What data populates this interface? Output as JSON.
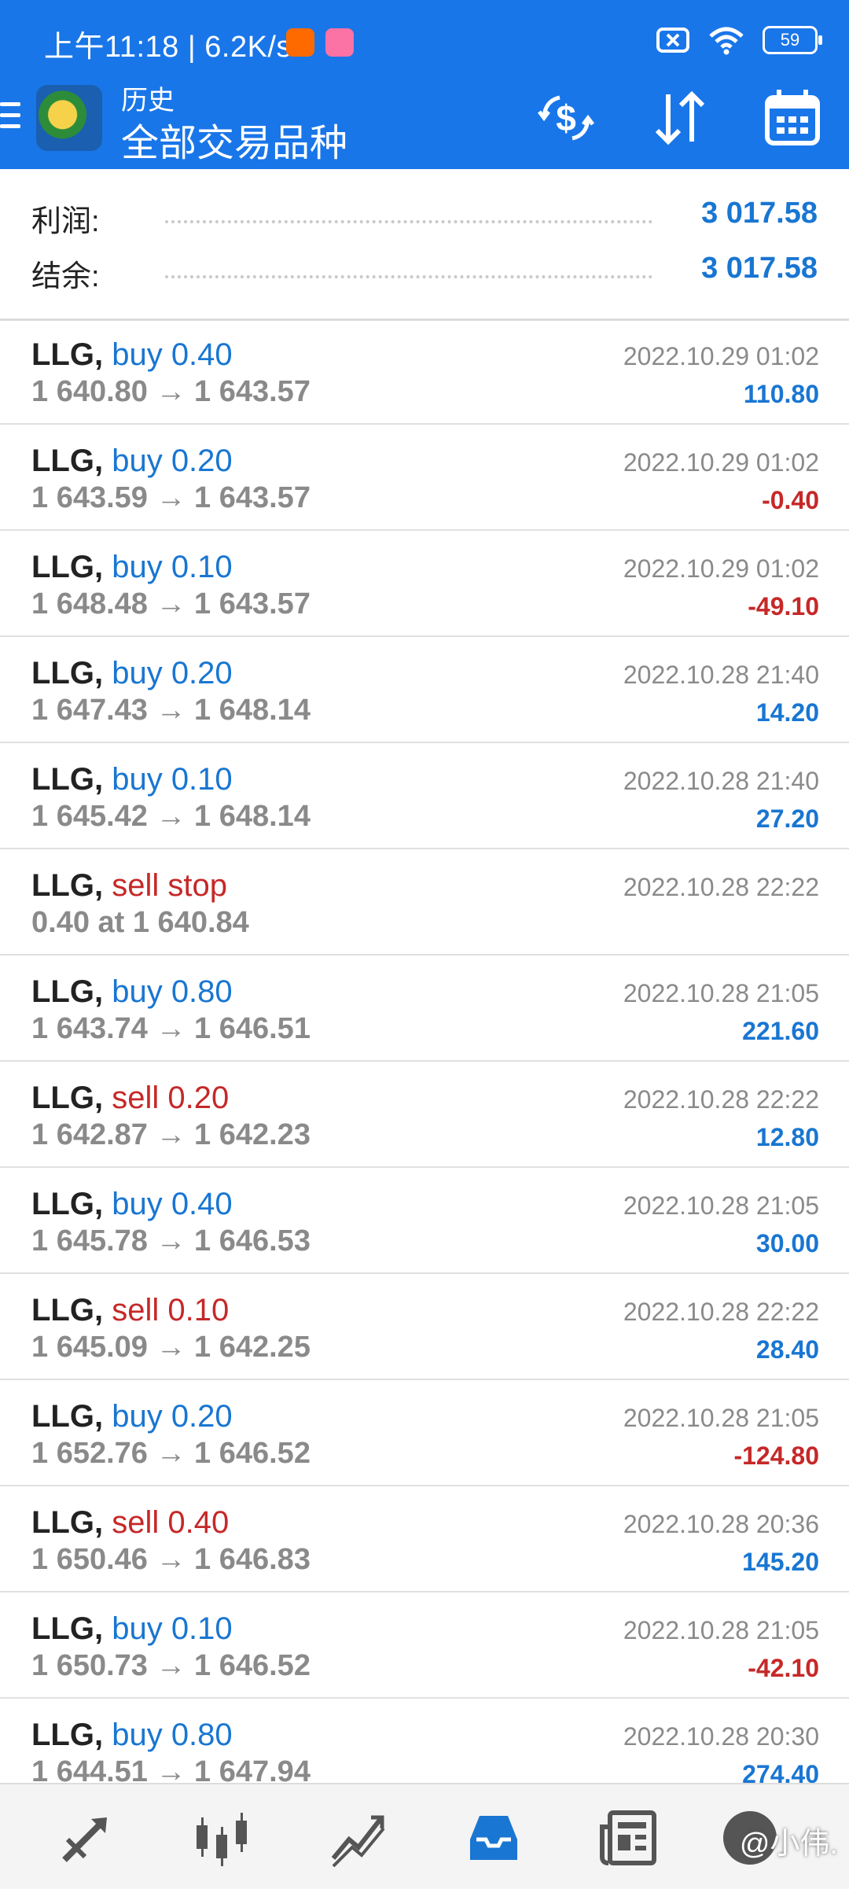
{
  "status_bar": {
    "time_speed": "上午11:18 | 6.2K/s",
    "battery": "59"
  },
  "toolbar": {
    "title_small": "历史",
    "title_big": "全部交易品种"
  },
  "summary": {
    "profit_label": "利润:",
    "profit_value": "3 017.58",
    "balance_label": "结余:",
    "balance_value": "3 017.58"
  },
  "trades": [
    {
      "symbol": "LLG,",
      "side": " buy 0.40",
      "side_type": "buy",
      "prices": "1 640.80 → 1 643.57",
      "time": "2022.10.29 01:02",
      "profit": "110.80",
      "profit_type": "pos"
    },
    {
      "symbol": "LLG,",
      "side": " buy 0.20",
      "side_type": "buy",
      "prices": "1 643.59 → 1 643.57",
      "time": "2022.10.29 01:02",
      "profit": "-0.40",
      "profit_type": "neg"
    },
    {
      "symbol": "LLG,",
      "side": " buy 0.10",
      "side_type": "buy",
      "prices": "1 648.48 → 1 643.57",
      "time": "2022.10.29 01:02",
      "profit": "-49.10",
      "profit_type": "neg"
    },
    {
      "symbol": "LLG,",
      "side": " buy 0.20",
      "side_type": "buy",
      "prices": "1 647.43 → 1 648.14",
      "time": "2022.10.28 21:40",
      "profit": "14.20",
      "profit_type": "pos"
    },
    {
      "symbol": "LLG,",
      "side": " buy 0.10",
      "side_type": "buy",
      "prices": "1 645.42 → 1 648.14",
      "time": "2022.10.28 21:40",
      "profit": "27.20",
      "profit_type": "pos"
    },
    {
      "symbol": "LLG,",
      "side": " sell stop",
      "side_type": "sell",
      "prices": "0.40 at 1 640.84",
      "time": "2022.10.28 22:22",
      "profit": "",
      "profit_type": "pos"
    },
    {
      "symbol": "LLG,",
      "side": " buy 0.80",
      "side_type": "buy",
      "prices": "1 643.74 → 1 646.51",
      "time": "2022.10.28 21:05",
      "profit": "221.60",
      "profit_type": "pos"
    },
    {
      "symbol": "LLG,",
      "side": " sell 0.20",
      "side_type": "sell",
      "prices": "1 642.87 → 1 642.23",
      "time": "2022.10.28 22:22",
      "profit": "12.80",
      "profit_type": "pos"
    },
    {
      "symbol": "LLG,",
      "side": " buy 0.40",
      "side_type": "buy",
      "prices": "1 645.78 → 1 646.53",
      "time": "2022.10.28 21:05",
      "profit": "30.00",
      "profit_type": "pos"
    },
    {
      "symbol": "LLG,",
      "side": " sell 0.10",
      "side_type": "sell",
      "prices": "1 645.09 → 1 642.25",
      "time": "2022.10.28 22:22",
      "profit": "28.40",
      "profit_type": "pos"
    },
    {
      "symbol": "LLG,",
      "side": " buy 0.20",
      "side_type": "buy",
      "prices": "1 652.76 → 1 646.52",
      "time": "2022.10.28 21:05",
      "profit": "-124.80",
      "profit_type": "neg"
    },
    {
      "symbol": "LLG,",
      "side": " sell 0.40",
      "side_type": "sell",
      "prices": "1 650.46 → 1 646.83",
      "time": "2022.10.28 20:36",
      "profit": "145.20",
      "profit_type": "pos"
    },
    {
      "symbol": "LLG,",
      "side": " buy 0.10",
      "side_type": "buy",
      "prices": "1 650.73 → 1 646.52",
      "time": "2022.10.28 21:05",
      "profit": "-42.10",
      "profit_type": "neg"
    },
    {
      "symbol": "LLG,",
      "side": " buy 0.80",
      "side_type": "buy",
      "prices": "1 644.51 → 1 647.94",
      "time": "2022.10.28 20:30",
      "profit": "274.40",
      "profit_type": "pos"
    }
  ],
  "colors": {
    "primary": "#1976e9",
    "buy": "#1976d2",
    "sell": "#c62828",
    "muted": "#8a8a8a"
  },
  "icons": {
    "toolbar": [
      "currency-exchange-icon",
      "sort-icon",
      "calendar-icon"
    ],
    "bottom_nav": [
      "trade-icon",
      "chart-candles-icon",
      "trend-icon",
      "history-inbox-icon",
      "news-icon",
      "profile-icon"
    ]
  },
  "watermark": "@小伟."
}
